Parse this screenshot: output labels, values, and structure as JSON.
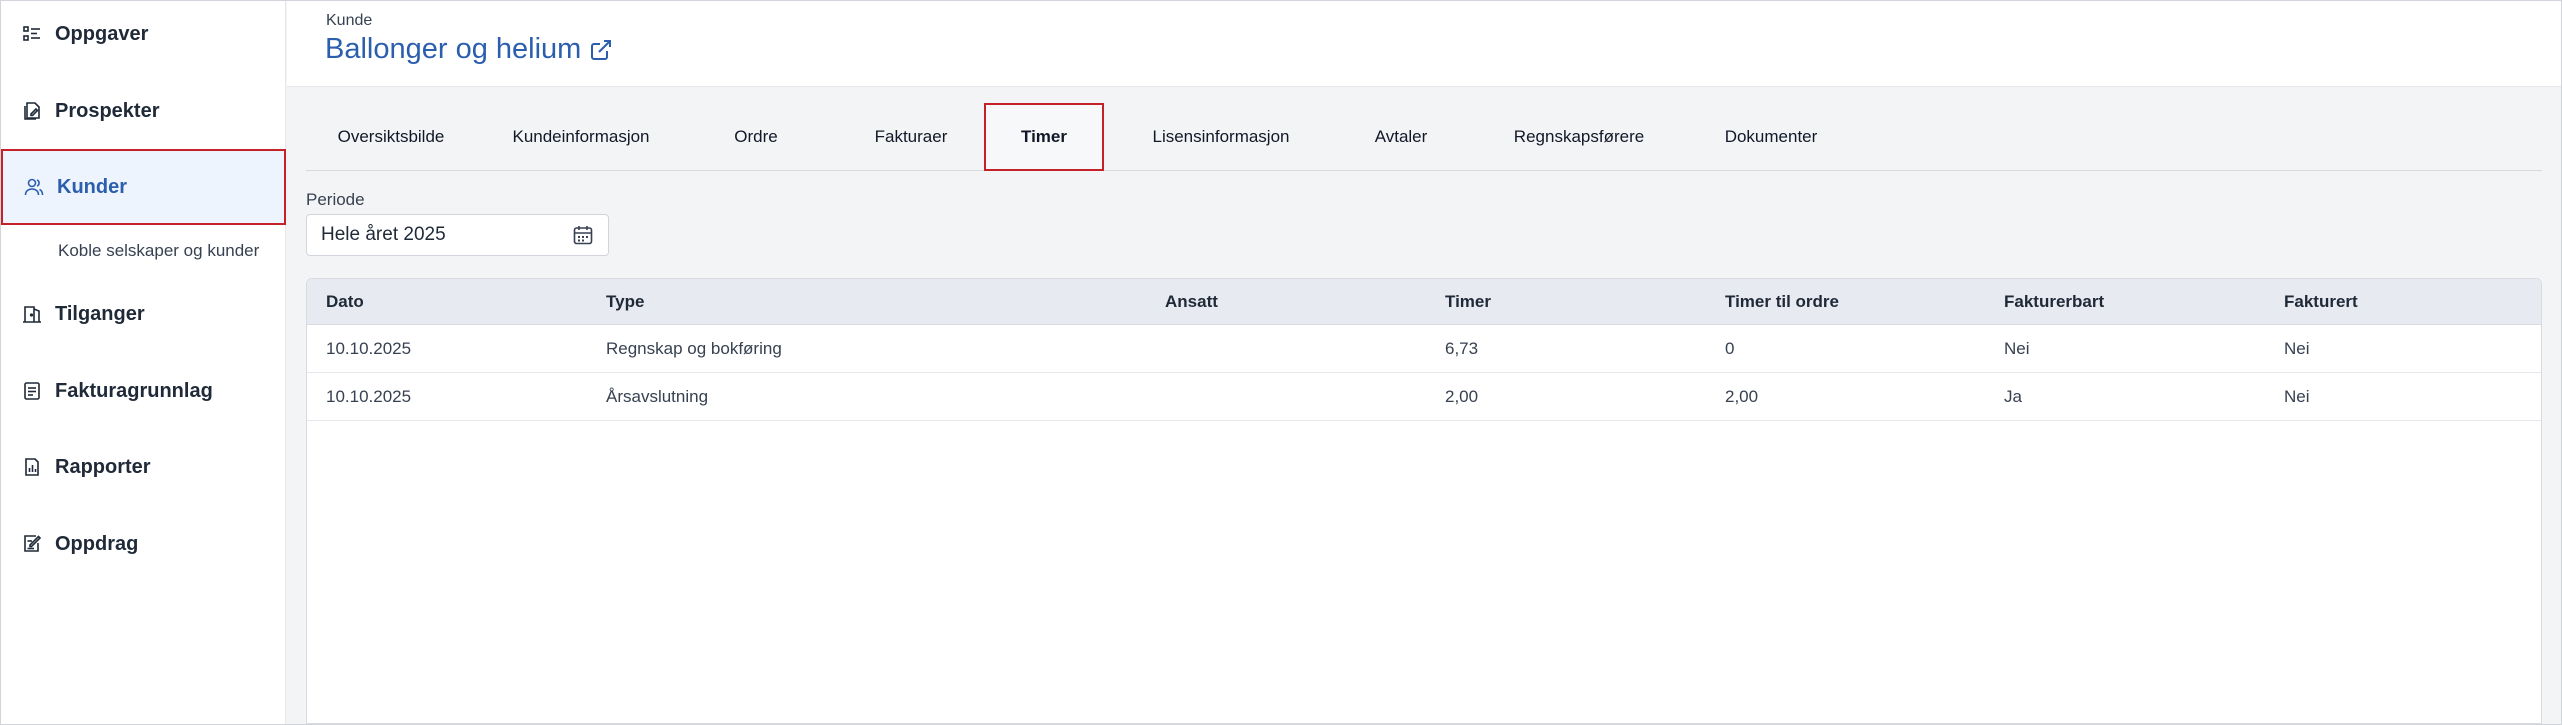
{
  "sidebar": {
    "items": [
      {
        "label": "Oppgaver",
        "icon": "task-list-icon"
      },
      {
        "label": "Prospekter",
        "icon": "document-edit-icon"
      },
      {
        "label": "Kunder",
        "icon": "users-icon"
      },
      {
        "label": "Tilganger",
        "icon": "door-key-icon"
      },
      {
        "label": "Fakturagrunnlag",
        "icon": "invoice-list-icon"
      },
      {
        "label": "Rapporter",
        "icon": "report-chart-icon"
      },
      {
        "label": "Oppdrag",
        "icon": "edit-square-icon"
      }
    ],
    "sub_item": "Koble selskaper og kunder"
  },
  "header": {
    "kicker": "Kunde",
    "title": "Ballonger og helium"
  },
  "tabs": [
    {
      "label": "Oversiktsbilde"
    },
    {
      "label": "Kundeinformasjon"
    },
    {
      "label": "Ordre"
    },
    {
      "label": "Fakturaer"
    },
    {
      "label": "Timer"
    },
    {
      "label": "Lisensinformasjon"
    },
    {
      "label": "Avtaler"
    },
    {
      "label": "Regnskapsførere"
    },
    {
      "label": "Dokumenter"
    }
  ],
  "active_tab": "Timer",
  "period": {
    "label": "Periode",
    "value": "Hele året 2025"
  },
  "table": {
    "columns": [
      "Dato",
      "Type",
      "Ansatt",
      "Timer",
      "Timer til ordre",
      "Fakturerbart",
      "Fakturert"
    ],
    "rows": [
      [
        "10.10.2025",
        "Regnskap og bokføring",
        "",
        "6,73",
        "0",
        "Nei",
        "Nei"
      ],
      [
        "10.10.2025",
        "Årsavslutning",
        "",
        "2,00",
        "2,00",
        "Ja",
        "Nei"
      ]
    ]
  },
  "colors": {
    "accent": "#2b5fae",
    "highlight_border": "#c42128",
    "active_bg": "#eef4fd",
    "table_header_bg": "#e7ebf1"
  }
}
